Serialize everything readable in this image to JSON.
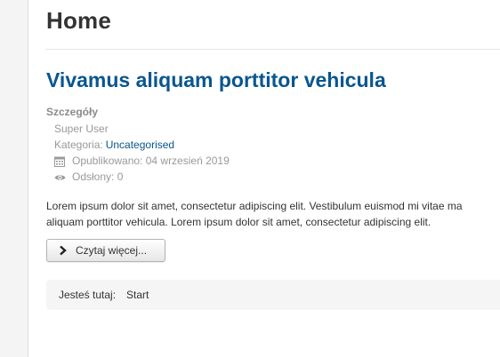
{
  "page": {
    "title": "Home"
  },
  "article": {
    "title": "Vivamus aliquam porttitor vehicula",
    "details": {
      "heading": "Szczegóły",
      "author": "Super User",
      "category_label": "Kategoria:",
      "category_value": "Uncategorised",
      "published": "Opublikowano: 04 wrzesień 2019",
      "hits": "Odsłony: 0"
    },
    "intro_line1": "Lorem ipsum dolor sit amet, consectetur adipiscing elit. Vestibulum euismod mi vitae ma",
    "intro_line2": "aliquam porttitor vehicula. Lorem ipsum dolor sit amet, consectetur adipiscing elit.",
    "readmore_label": "Czytaj więcej..."
  },
  "breadcrumb": {
    "label": "Jesteś tutaj:",
    "current": "Start"
  },
  "colors": {
    "link": "#08568f",
    "text": "#333333",
    "muted": "#999999"
  },
  "icons": {
    "published": "calendar-icon",
    "hits": "eye-icon",
    "readmore": "chevron-right-icon"
  }
}
